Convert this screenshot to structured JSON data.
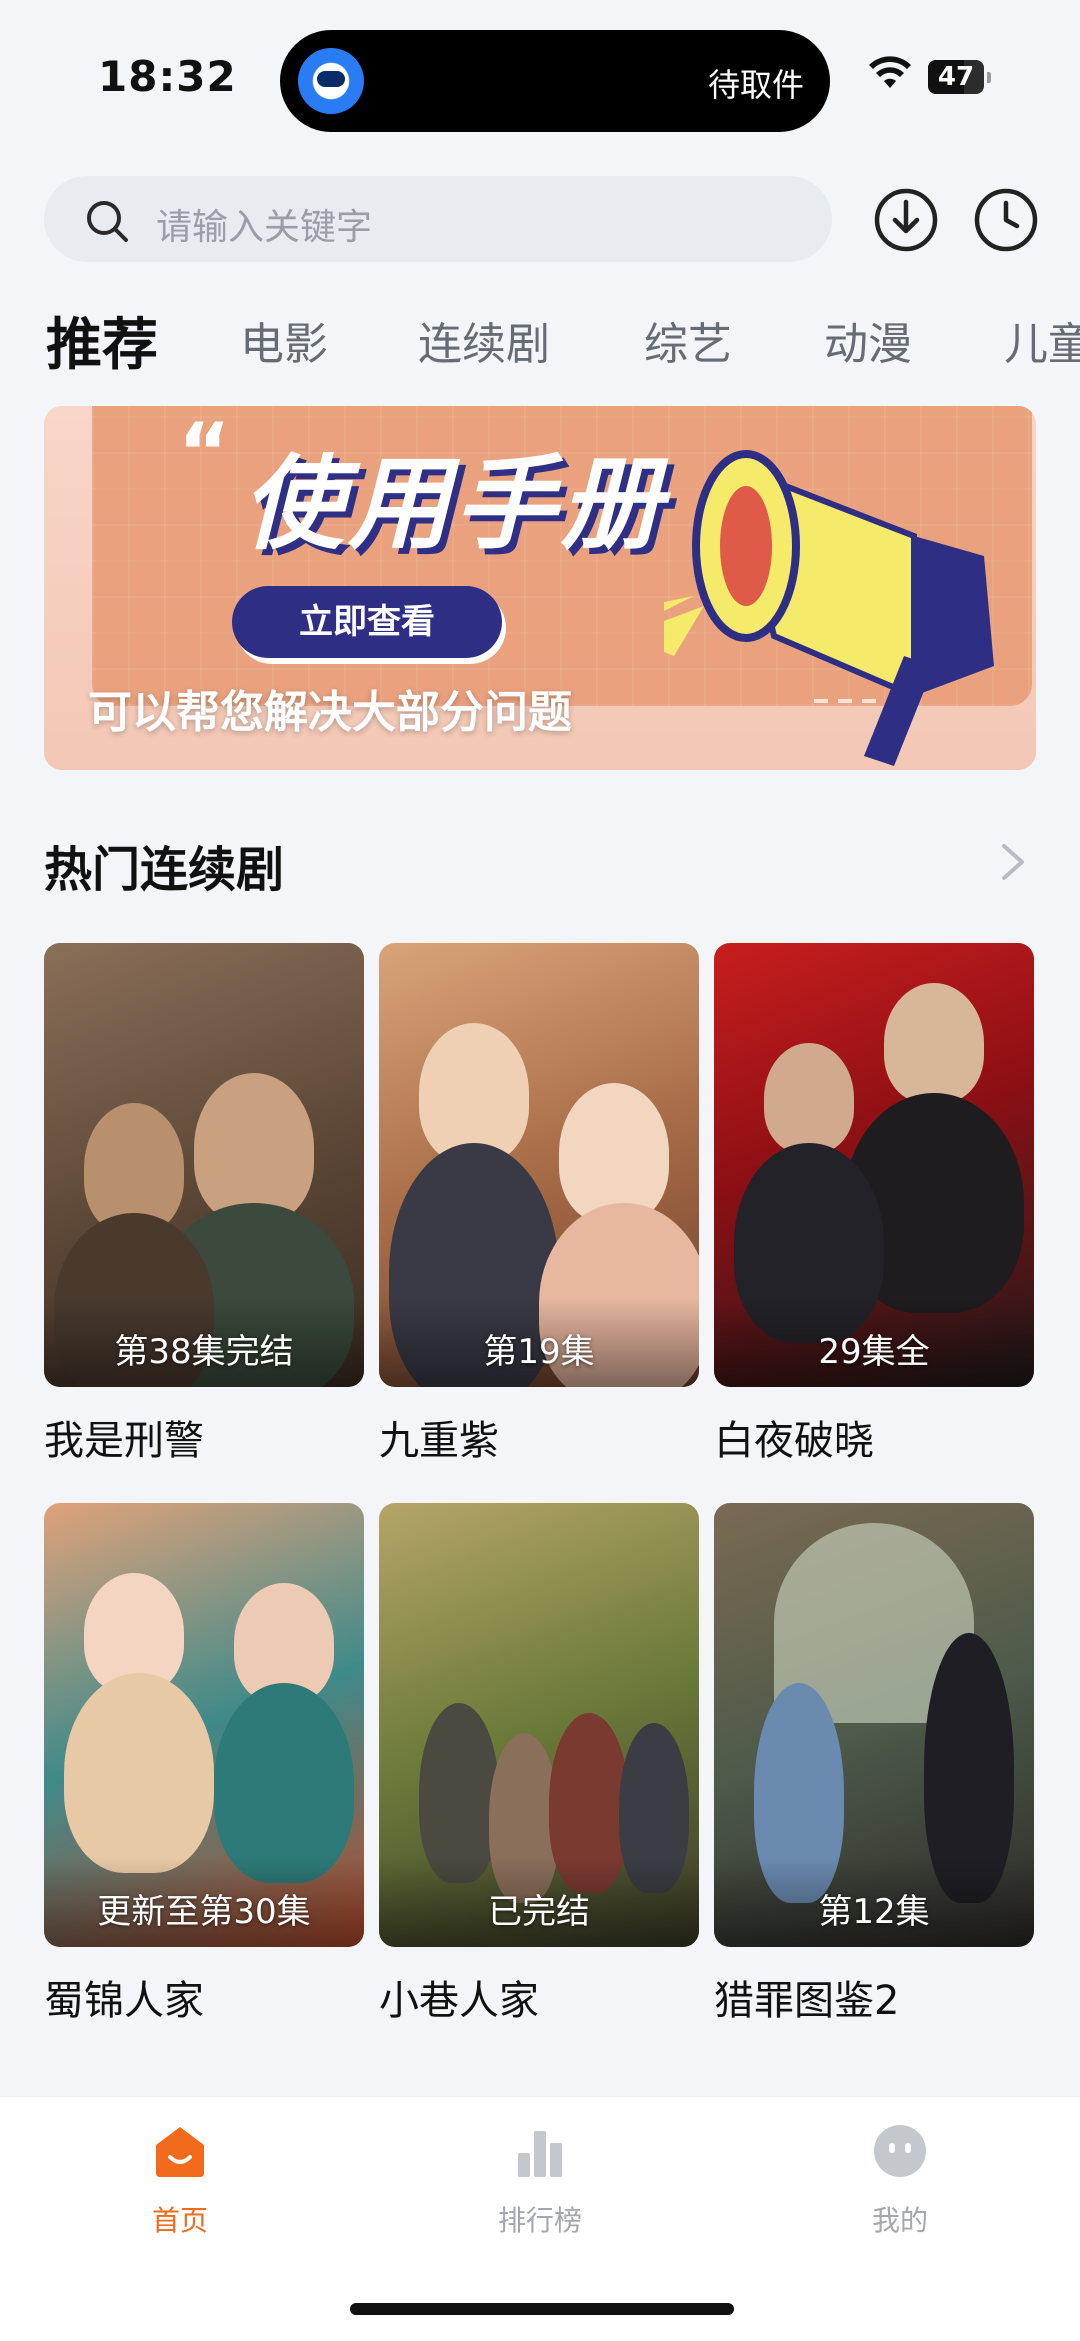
{
  "status_bar": {
    "time": "18:32",
    "island_text": "待取件",
    "battery_level": "47"
  },
  "search": {
    "placeholder": "请输入关键字",
    "icons": [
      "search-icon",
      "download-icon",
      "history-icon"
    ]
  },
  "tabs": [
    {
      "label": "推荐",
      "active": true
    },
    {
      "label": "电影",
      "active": false
    },
    {
      "label": "连续剧",
      "active": false
    },
    {
      "label": "综艺",
      "active": false
    },
    {
      "label": "动漫",
      "active": false
    },
    {
      "label": "儿童",
      "active": false
    }
  ],
  "banner": {
    "title": "使用手册",
    "button_label": "立即查看",
    "caption": "可以帮您解决大部分问题"
  },
  "section": {
    "title": "热门连续剧",
    "more_icon": "chevron-right-icon"
  },
  "shows": [
    {
      "title": "我是刑警",
      "status": "第38集完结"
    },
    {
      "title": "九重紫",
      "status": "第19集"
    },
    {
      "title": "白夜破晓",
      "status": "29集全"
    },
    {
      "title": "蜀锦人家",
      "status": "更新至第30集"
    },
    {
      "title": "小巷人家",
      "status": "已完结"
    },
    {
      "title": "猎罪图鉴2",
      "status": "第12集"
    }
  ],
  "bottom_nav": [
    {
      "label": "首页",
      "icon": "home-icon",
      "active": true
    },
    {
      "label": "排行榜",
      "icon": "ranking-icon",
      "active": false
    },
    {
      "label": "我的",
      "icon": "profile-icon",
      "active": false
    }
  ],
  "colors": {
    "accent": "#f26a1b",
    "background": "#f3f5f8",
    "banner_button": "#2e2f84"
  }
}
